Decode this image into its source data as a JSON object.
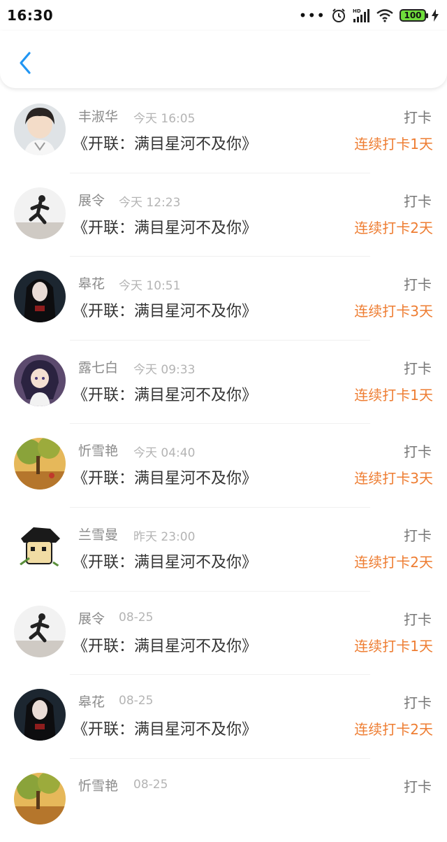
{
  "status_bar": {
    "time": "16:30",
    "battery": "100",
    "network_badge": "HD"
  },
  "header": {
    "back_icon": "chevron-left-icon",
    "accent": "#2196f3"
  },
  "colors": {
    "streak": "#ee7d32",
    "name": "#8a8a8a",
    "time": "#b4b4b4"
  },
  "items": [
    {
      "name": "丰淑华",
      "time": "今天 16:05",
      "book": "《开联：满目星河不及你》",
      "action": "打卡",
      "streak": "连续打卡1天"
    },
    {
      "name": "展令",
      "time": "今天 12:23",
      "book": "《开联：满目星河不及你》",
      "action": "打卡",
      "streak": "连续打卡2天"
    },
    {
      "name": "皋花",
      "time": "今天 10:51",
      "book": "《开联：满目星河不及你》",
      "action": "打卡",
      "streak": "连续打卡3天"
    },
    {
      "name": "露七白",
      "time": "今天 09:33",
      "book": "《开联：满目星河不及你》",
      "action": "打卡",
      "streak": "连续打卡1天"
    },
    {
      "name": "忻雪艳",
      "time": "今天 04:40",
      "book": "《开联：满目星河不及你》",
      "action": "打卡",
      "streak": "连续打卡3天"
    },
    {
      "name": "兰雪曼",
      "time": "昨天 23:00",
      "book": "《开联：满目星河不及你》",
      "action": "打卡",
      "streak": "连续打卡2天"
    },
    {
      "name": "展令",
      "time": "08-25",
      "book": "《开联：满目星河不及你》",
      "action": "打卡",
      "streak": "连续打卡1天"
    },
    {
      "name": "皋花",
      "time": "08-25",
      "book": "《开联：满目星河不及你》",
      "action": "打卡",
      "streak": "连续打卡2天"
    },
    {
      "name": "忻雪艳",
      "time": "08-25",
      "book": "",
      "action": "打卡",
      "streak": ""
    }
  ]
}
